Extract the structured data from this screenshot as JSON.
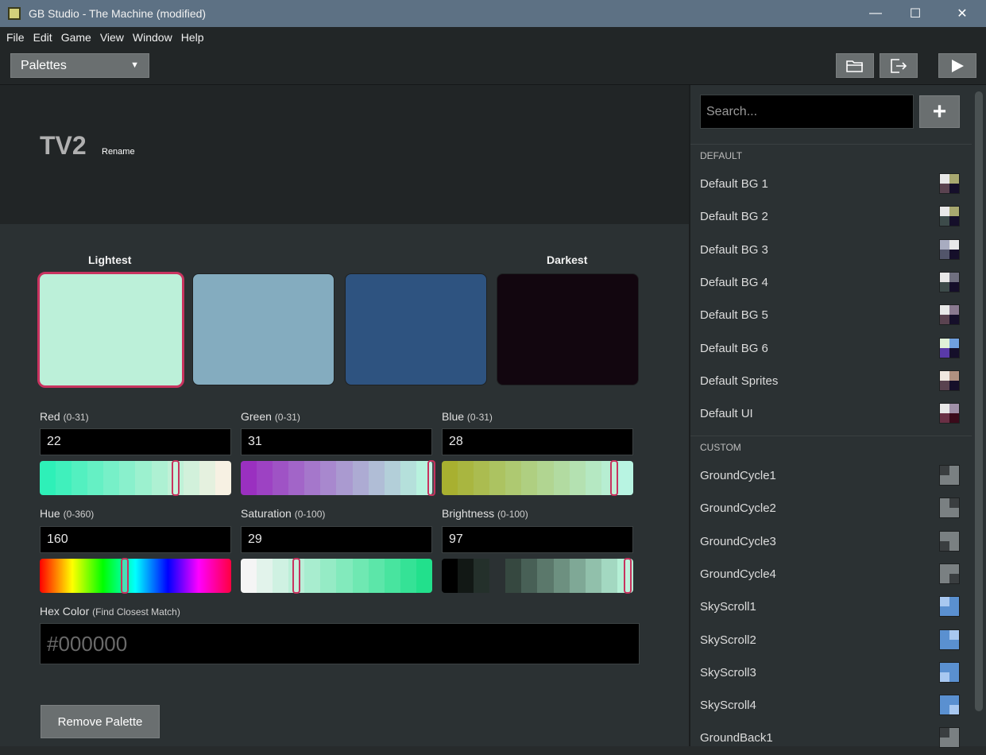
{
  "window": {
    "title": "GB Studio - The Machine (modified)",
    "minimize": "—",
    "maximize": "☐",
    "close": "✕"
  },
  "menu": [
    "File",
    "Edit",
    "Game",
    "View",
    "Window",
    "Help"
  ],
  "toolbar": {
    "section": "Palettes",
    "open_folder_icon": "folder-open-icon",
    "export_icon": "export-icon",
    "play_icon": "play-icon"
  },
  "editor": {
    "palette_name": "TV2",
    "rename_label": "Rename",
    "lightest_label": "Lightest",
    "darkest_label": "Darkest",
    "swatches": [
      "#bcf0d9",
      "#84acbf",
      "#2e5380",
      "#12060f"
    ],
    "selected_swatch": 0,
    "fields": {
      "red": {
        "label": "Red",
        "range": "(0-31)",
        "value": "22"
      },
      "green": {
        "label": "Green",
        "range": "(0-31)",
        "value": "31"
      },
      "blue": {
        "label": "Blue",
        "range": "(0-31)",
        "value": "28"
      },
      "hue": {
        "label": "Hue",
        "range": "(0-360)",
        "value": "160"
      },
      "saturation": {
        "label": "Saturation",
        "range": "(0-100)",
        "value": "29"
      },
      "brightness": {
        "label": "Brightness",
        "range": "(0-100)",
        "value": "97"
      }
    },
    "hex": {
      "label": "Hex Color",
      "hint": "(Find Closest Match)",
      "placeholder": "#000000"
    },
    "remove_label": "Remove Palette"
  },
  "sidebar": {
    "search_placeholder": "Search...",
    "add_label": "+",
    "groups": [
      {
        "name": "DEFAULT",
        "items": [
          {
            "label": "Default BG 1",
            "thumb": [
              "#e8e8e8",
              "#a8a870",
              "#5a4350",
              "#150f2a"
            ]
          },
          {
            "label": "Default BG 2",
            "thumb": [
              "#e8e8e8",
              "#a8a870",
              "#3d4b4a",
              "#150f2a"
            ]
          },
          {
            "label": "Default BG 3",
            "thumb": [
              "#a8acc0",
              "#e8e8e8",
              "#52556a",
              "#150f2a"
            ]
          },
          {
            "label": "Default BG 4",
            "thumb": [
              "#e8e8e8",
              "#707080",
              "#3d4b4a",
              "#150f2a"
            ]
          },
          {
            "label": "Default BG 5",
            "thumb": [
              "#e8e8e8",
              "#8a7a90",
              "#5a4350",
              "#150f2a"
            ]
          },
          {
            "label": "Default BG 6",
            "thumb": [
              "#e0f0d8",
              "#70a0e0",
              "#5a3aa8",
              "#150f2a"
            ]
          },
          {
            "label": "Default Sprites",
            "thumb": [
              "#f0e8e0",
              "#b09080",
              "#5a4350",
              "#150f2a"
            ]
          },
          {
            "label": "Default UI",
            "thumb": [
              "#e8e8e8",
              "#a090a8",
              "#6a3045",
              "#3a0a1a"
            ]
          }
        ]
      },
      {
        "name": "CUSTOM",
        "items": [
          {
            "label": "GroundCycle1",
            "thumb": [
              "#3a3e40",
              "#7a8082",
              "#7a8082",
              "#7a8082"
            ]
          },
          {
            "label": "GroundCycle2",
            "thumb": [
              "#7a8082",
              "#3a3e40",
              "#7a8082",
              "#7a8082"
            ]
          },
          {
            "label": "GroundCycle3",
            "thumb": [
              "#7a8082",
              "#7a8082",
              "#3a3e40",
              "#7a8082"
            ]
          },
          {
            "label": "GroundCycle4",
            "thumb": [
              "#7a8082",
              "#7a8082",
              "#7a8082",
              "#3a3e40"
            ]
          },
          {
            "label": "SkyScroll1",
            "thumb": [
              "#a8c8f0",
              "#5a90d0",
              "#5a90d0",
              "#5a90d0"
            ]
          },
          {
            "label": "SkyScroll2",
            "thumb": [
              "#5a90d0",
              "#a8c8f0",
              "#5a90d0",
              "#5a90d0"
            ]
          },
          {
            "label": "SkyScroll3",
            "thumb": [
              "#5a90d0",
              "#5a90d0",
              "#a8c8f0",
              "#5a90d0"
            ]
          },
          {
            "label": "SkyScroll4",
            "thumb": [
              "#5a90d0",
              "#5a90d0",
              "#5a90d0",
              "#a8c8f0"
            ]
          },
          {
            "label": "GroundBack1",
            "thumb": [
              "#3a3e40",
              "#7a8082",
              "#7a8082",
              "#7a8082"
            ]
          }
        ]
      }
    ]
  },
  "colors": {
    "accent": "#c8335f",
    "background": "#2b3133",
    "titlebar": "#5d7184"
  }
}
